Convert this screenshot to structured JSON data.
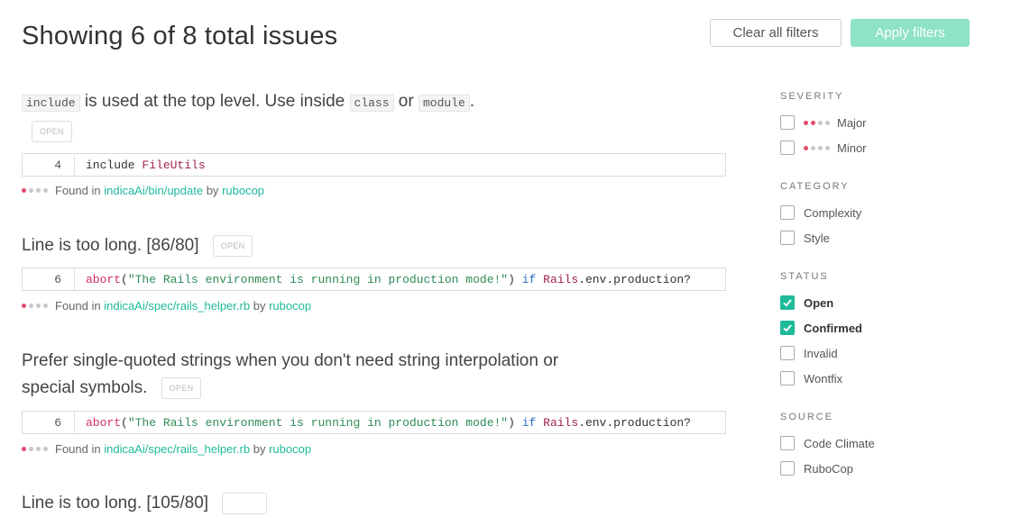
{
  "header": {
    "title": "Showing 6 of 8 total issues",
    "clear_label": "Clear all filters",
    "apply_label": "Apply filters"
  },
  "issues": [
    {
      "title_parts": [
        "include",
        " is used at the top level. Use inside ",
        "class",
        " or ",
        "module",
        "."
      ],
      "status": "OPEN",
      "line": "4",
      "code_parts": [
        "include ",
        "FileUtils"
      ],
      "found_prefix": "Found in",
      "path": "indicaAi/bin/update",
      "by": "by",
      "engine": "rubocop",
      "severity_dots": 1
    },
    {
      "title": "Line is too long. [86/80]",
      "status": "OPEN",
      "line": "6",
      "code_parts": [
        "abort",
        "(",
        "\"The Rails environment is running in production mode!\"",
        ") ",
        "if",
        " ",
        "Rails",
        ".env.production?"
      ],
      "found_prefix": "Found in",
      "path": "indicaAi/spec/rails_helper.rb",
      "by": "by",
      "engine": "rubocop",
      "severity_dots": 1
    },
    {
      "title_line1": "Prefer single-quoted strings when you don't need string interpolation or",
      "title_line2": "special symbols.",
      "status": "OPEN",
      "line": "6",
      "code_parts": [
        "abort",
        "(",
        "\"The Rails environment is running in production mode!\"",
        ") ",
        "if",
        " ",
        "Rails",
        ".env.production?"
      ],
      "found_prefix": "Found in",
      "path": "indicaAi/spec/rails_helper.rb",
      "by": "by",
      "engine": "rubocop",
      "severity_dots": 1
    },
    {
      "title": "Line is too long. [105/80]"
    }
  ],
  "filters": {
    "severity": {
      "heading": "SEVERITY",
      "options": [
        {
          "label": "Major",
          "checked": false,
          "red_dots": 1
        },
        {
          "label": "Minor",
          "checked": false,
          "red_dots": 1
        }
      ]
    },
    "category": {
      "heading": "CATEGORY",
      "options": [
        {
          "label": "Complexity",
          "checked": false
        },
        {
          "label": "Style",
          "checked": false
        }
      ]
    },
    "status": {
      "heading": "STATUS",
      "options": [
        {
          "label": "Open",
          "checked": true
        },
        {
          "label": "Confirmed",
          "checked": true
        },
        {
          "label": "Invalid",
          "checked": false
        },
        {
          "label": "Wontfix",
          "checked": false
        }
      ]
    },
    "source": {
      "heading": "SOURCE",
      "options": [
        {
          "label": "Code Climate",
          "checked": false
        },
        {
          "label": "RuboCop",
          "checked": false
        }
      ]
    }
  },
  "colors": {
    "accent": "#1fba9a",
    "apply_button": "#8ee2c5",
    "severity_red": "#e44a6a"
  },
  "icons": {
    "checkbox_checked": "check-icon",
    "severity": "severity-dots-icon"
  }
}
